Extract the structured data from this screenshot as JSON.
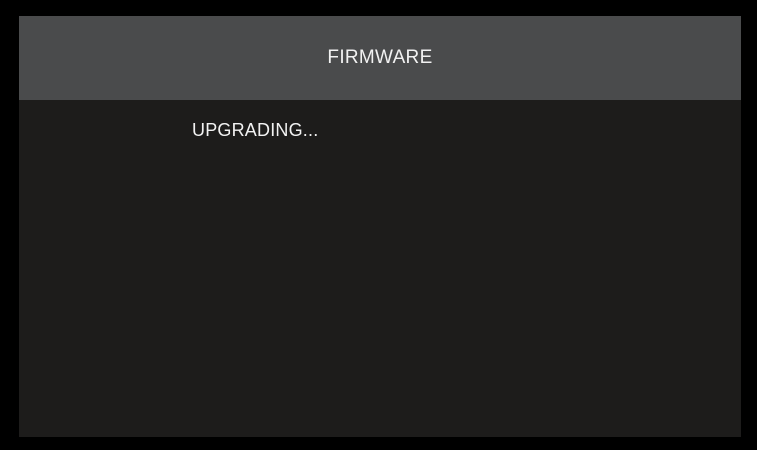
{
  "header": {
    "title": "FIRMWARE"
  },
  "main": {
    "status": "UPGRADING..."
  },
  "colors": {
    "bezel": "#000000",
    "header_background": "#4a4b4c",
    "screen_background": "#1d1c1b",
    "text": "#f2f2f2"
  }
}
